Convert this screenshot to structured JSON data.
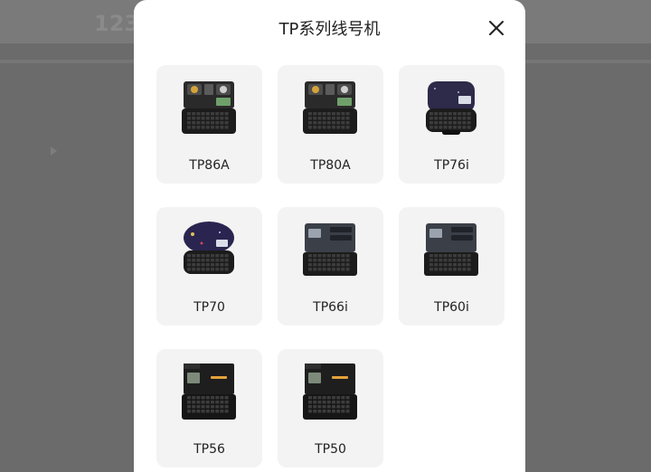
{
  "background": {
    "number_fragment": "123"
  },
  "modal": {
    "title": "TP系列线号机",
    "close_icon": "close-icon",
    "products": [
      {
        "name": "TP86A",
        "style": "dual-cassette"
      },
      {
        "name": "TP80A",
        "style": "dual-cassette"
      },
      {
        "name": "TP76i",
        "style": "purple-round"
      },
      {
        "name": "TP70",
        "style": "purple-dome"
      },
      {
        "name": "TP66i",
        "style": "gray-box"
      },
      {
        "name": "TP60i",
        "style": "gray-box"
      },
      {
        "name": "TP56",
        "style": "black-box"
      },
      {
        "name": "TP50",
        "style": "black-box"
      }
    ]
  },
  "colors": {
    "backdrop": "#6b6b6b",
    "card_bg": "#f3f3f3",
    "text": "#222222"
  }
}
